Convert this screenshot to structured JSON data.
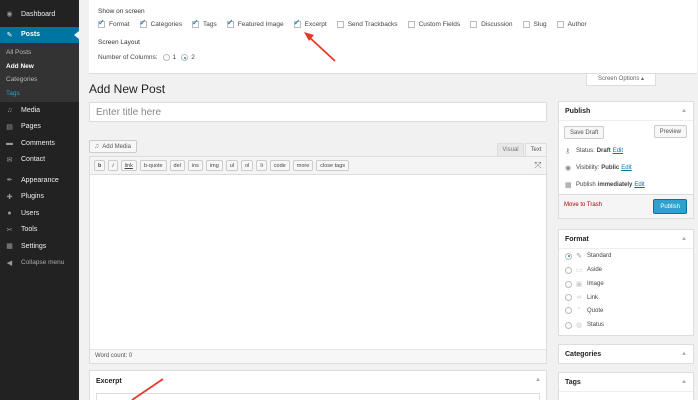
{
  "sidebar": {
    "items": [
      {
        "icon": "dashboard-icon",
        "glyph": "◉",
        "label": "Dashboard"
      },
      {
        "icon": "pin-icon",
        "glyph": "✎",
        "label": "Posts",
        "active": true
      },
      {
        "icon": "media-icon",
        "glyph": "♫",
        "label": "Media"
      },
      {
        "icon": "pages-icon",
        "glyph": "▤",
        "label": "Pages"
      },
      {
        "icon": "comments-icon",
        "glyph": "▬",
        "label": "Comments"
      },
      {
        "icon": "contact-icon",
        "glyph": "✉",
        "label": "Contact"
      },
      {
        "icon": "appearance-icon",
        "glyph": "✒",
        "label": "Appearance"
      },
      {
        "icon": "plugins-icon",
        "glyph": "✚",
        "label": "Plugins"
      },
      {
        "icon": "users-icon",
        "glyph": "●",
        "label": "Users"
      },
      {
        "icon": "tools-icon",
        "glyph": "✂",
        "label": "Tools"
      },
      {
        "icon": "settings-icon",
        "glyph": "▦",
        "label": "Settings"
      },
      {
        "icon": "collapse-icon",
        "glyph": "◀",
        "label": "Collapse menu"
      }
    ],
    "posts_submenu": [
      "All Posts",
      "Add New",
      "Categories",
      "Tags"
    ]
  },
  "screen_options": {
    "title": "Show on screen",
    "boxes": [
      {
        "label": "Format",
        "checked": true
      },
      {
        "label": "Categories",
        "checked": true
      },
      {
        "label": "Tags",
        "checked": true
      },
      {
        "label": "Featured Image",
        "checked": true
      },
      {
        "label": "Excerpt",
        "checked": true
      },
      {
        "label": "Send Trackbacks",
        "checked": false
      },
      {
        "label": "Custom Fields",
        "checked": false
      },
      {
        "label": "Discussion",
        "checked": false
      },
      {
        "label": "Slug",
        "checked": false
      },
      {
        "label": "Author",
        "checked": false
      }
    ],
    "layout_title": "Screen Layout",
    "columns_label": "Number of Columns:",
    "column_options": [
      "1",
      "2"
    ],
    "columns_selected": "2",
    "tab_label": "Screen Options ▴"
  },
  "heading": "Add New Post",
  "title_placeholder": "Enter title here",
  "editor": {
    "add_media": "Add Media",
    "tab_visual": "Visual",
    "tab_text": "Text",
    "active_tab": "Text",
    "quicktags": [
      "b",
      "i",
      "link",
      "b-quote",
      "del",
      "ins",
      "img",
      "ul",
      "ol",
      "li",
      "code",
      "more",
      "close tags"
    ],
    "word_count": "Word count: 0"
  },
  "excerpt": {
    "title": "Excerpt"
  },
  "publish": {
    "title": "Publish",
    "save_draft": "Save Draft",
    "preview": "Preview",
    "status_label": "Status:",
    "status_value": "Draft",
    "visibility_label": "Visibility:",
    "visibility_value": "Public",
    "publish_label": "Publish",
    "publish_value": "immediately",
    "edit": "Edit",
    "trash": "Move to Trash",
    "publish_button": "Publish"
  },
  "format": {
    "title": "Format",
    "options": [
      {
        "label": "Standard",
        "icon": "pushpin-icon",
        "glyph": "✎",
        "selected": true
      },
      {
        "label": "Aside",
        "icon": "aside-icon",
        "glyph": "▭",
        "selected": false
      },
      {
        "label": "Image",
        "icon": "image-icon",
        "glyph": "▣",
        "selected": false
      },
      {
        "label": "Link",
        "icon": "link-icon",
        "glyph": "∞",
        "selected": false
      },
      {
        "label": "Quote",
        "icon": "quote-icon",
        "glyph": "“",
        "selected": false
      },
      {
        "label": "Status",
        "icon": "status-icon",
        "glyph": "◍",
        "selected": false
      }
    ]
  },
  "categories": {
    "title": "Categories"
  },
  "tags": {
    "title": "Tags"
  },
  "colors": {
    "sidebar_bg": "#222222",
    "active_menu": "#0074a2",
    "primary_button": "#2ea2cc",
    "annotation_arrow": "#e53a2b",
    "trash_link": "#aa0000"
  }
}
